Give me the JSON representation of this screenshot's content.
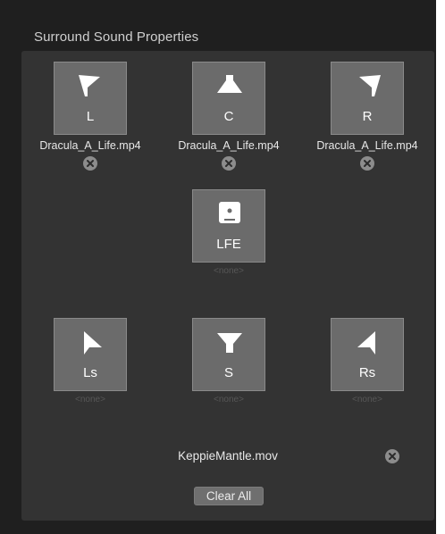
{
  "window": {
    "title": "Surround Sound Properties"
  },
  "channels": [
    {
      "id": "L",
      "label": "L",
      "icon": "speaker-front-left-icon",
      "assigned": "Dracula_A_Life.mp4"
    },
    {
      "id": "C",
      "label": "C",
      "icon": "speaker-center-icon",
      "assigned": "Dracula_A_Life.mp4"
    },
    {
      "id": "R",
      "label": "R",
      "icon": "speaker-front-right-icon",
      "assigned": "Dracula_A_Life.mp4"
    },
    {
      "id": "LFE",
      "label": "LFE",
      "icon": "subwoofer-icon",
      "assigned": "<none>"
    },
    {
      "id": "Ls",
      "label": "Ls",
      "icon": "speaker-left-surround-icon",
      "assigned": "<none>"
    },
    {
      "id": "S",
      "label": "S",
      "icon": "speaker-surround-icon",
      "assigned": "<none>"
    },
    {
      "id": "Rs",
      "label": "Rs",
      "icon": "speaker-right-surround-icon",
      "assigned": "<none>"
    }
  ],
  "source": {
    "file": "KeppieMantle.mov"
  },
  "actions": {
    "clear_all": "Clear All"
  },
  "icons": {
    "remove": "remove-x-circle-icon"
  },
  "colors": {
    "window_bg": "#1f1f1f",
    "panel_bg": "#333333",
    "tile_bg": "#6b6b6b",
    "tile_border": "#8a8a8a",
    "none_text": "#575757"
  }
}
